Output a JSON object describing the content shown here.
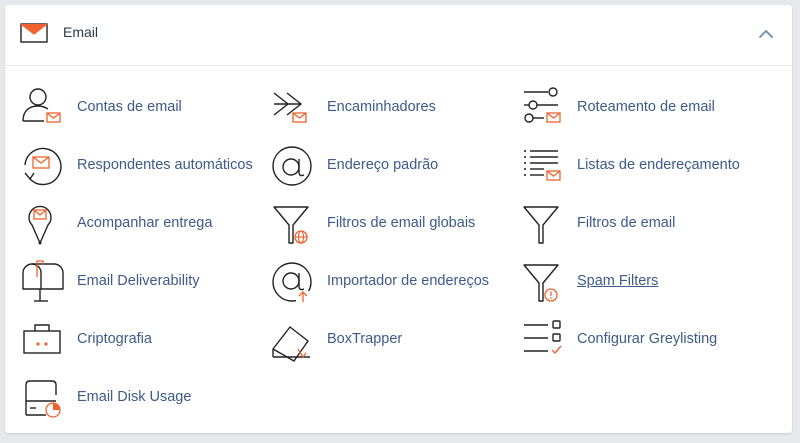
{
  "section": {
    "title": "Email",
    "header_icon": "envelope-icon",
    "collapse_icon": "chevron-up-icon"
  },
  "colors": {
    "link": "#3d5a8a",
    "icon_stroke": "#222222",
    "accent": "#f0622e"
  },
  "items": [
    {
      "label": "Contas de email",
      "icon": "user-mail-icon"
    },
    {
      "label": "Encaminhadores",
      "icon": "forward-arrows-icon"
    },
    {
      "label": "Roteamento de email",
      "icon": "routing-icon"
    },
    {
      "label": "Respondentes automáticos",
      "icon": "auto-reply-icon"
    },
    {
      "label": "Endereço padrão",
      "icon": "at-sign-icon"
    },
    {
      "label": "Listas de endereçamento",
      "icon": "mailing-list-icon"
    },
    {
      "label": "Acompanhar entrega",
      "icon": "map-pin-mail-icon"
    },
    {
      "label": "Filtros de email globais",
      "icon": "funnel-globe-icon"
    },
    {
      "label": "Filtros de email",
      "icon": "funnel-icon"
    },
    {
      "label": "Email Deliverability",
      "icon": "mailbox-icon"
    },
    {
      "label": "Importador de endereços",
      "icon": "at-import-icon"
    },
    {
      "label": "Spam Filters",
      "icon": "funnel-warning-icon"
    },
    {
      "label": "Criptografia",
      "icon": "encryption-icon"
    },
    {
      "label": "BoxTrapper",
      "icon": "boxtrapper-icon"
    },
    {
      "label": "Configurar Greylisting",
      "icon": "greylisting-icon"
    },
    {
      "label": "Email Disk Usage",
      "icon": "disk-usage-icon"
    }
  ]
}
